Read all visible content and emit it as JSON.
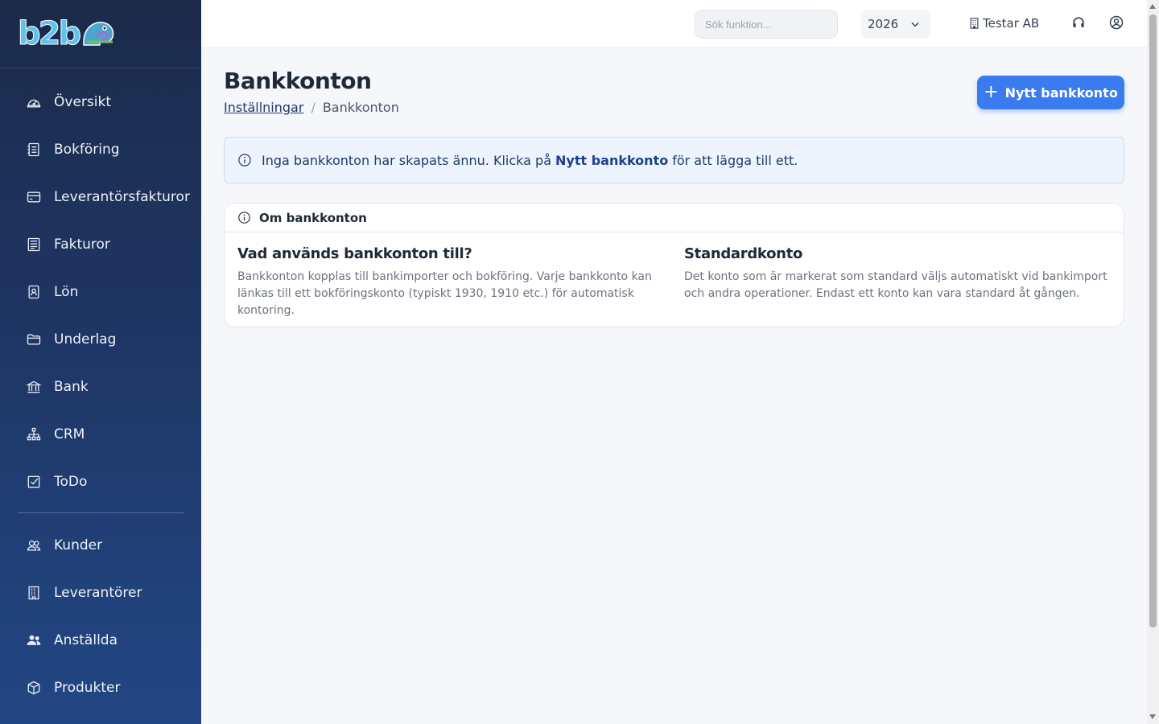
{
  "brand": {
    "logo_text": "b2b"
  },
  "sidebar": {
    "items": [
      {
        "label": "Översikt",
        "icon": "gauge-icon"
      },
      {
        "label": "Bokföring",
        "icon": "ledger-icon"
      },
      {
        "label": "Leverantörsfakturor",
        "icon": "credit-card-icon"
      },
      {
        "label": "Fakturor",
        "icon": "invoice-icon"
      },
      {
        "label": "Lön",
        "icon": "badge-icon"
      },
      {
        "label": "Underlag",
        "icon": "folder-icon"
      },
      {
        "label": "Bank",
        "icon": "bank-icon"
      },
      {
        "label": "CRM",
        "icon": "network-icon"
      },
      {
        "label": "ToDo",
        "icon": "checkbox-icon"
      }
    ],
    "items2": [
      {
        "label": "Kunder",
        "icon": "users-icon"
      },
      {
        "label": "Leverantörer",
        "icon": "building-icon"
      },
      {
        "label": "Anställda",
        "icon": "people-icon"
      },
      {
        "label": "Produkter",
        "icon": "box-icon"
      }
    ]
  },
  "topbar": {
    "search_placeholder": "Sök funktion...",
    "year": "2026",
    "company": "Testar AB"
  },
  "page": {
    "title": "Bankkonton",
    "breadcrumb_parent": "Inställningar",
    "breadcrumb_sep": "/",
    "breadcrumb_current": "Bankkonton",
    "new_button_plus": "+",
    "new_button_label": "Nytt bankkonto"
  },
  "alert": {
    "text_before": "Inga bankkonton har skapats ännu. Klicka på",
    "text_bold": "Nytt bankkonto",
    "text_after": "för att lägga till ett."
  },
  "info_card": {
    "header": "Om bankkonton",
    "col1_title": "Vad används bankkonton till?",
    "col1_text": "Bankkonton kopplas till bankimporter och bokföring. Varje bankkonto kan länkas till ett bokföringskonto (typiskt 1930, 1910 etc.) för automatisk kontoring.",
    "col2_title": "Standardkonto",
    "col2_text": "Det konto som är markerat som standard väljs automatiskt vid bankimport och andra operationer. Endast ett konto kan vara standard åt gången."
  },
  "colors": {
    "accent": "#3b7bf0",
    "sidebar": "#1f3a6c",
    "alert_bg": "#eef4fd"
  }
}
